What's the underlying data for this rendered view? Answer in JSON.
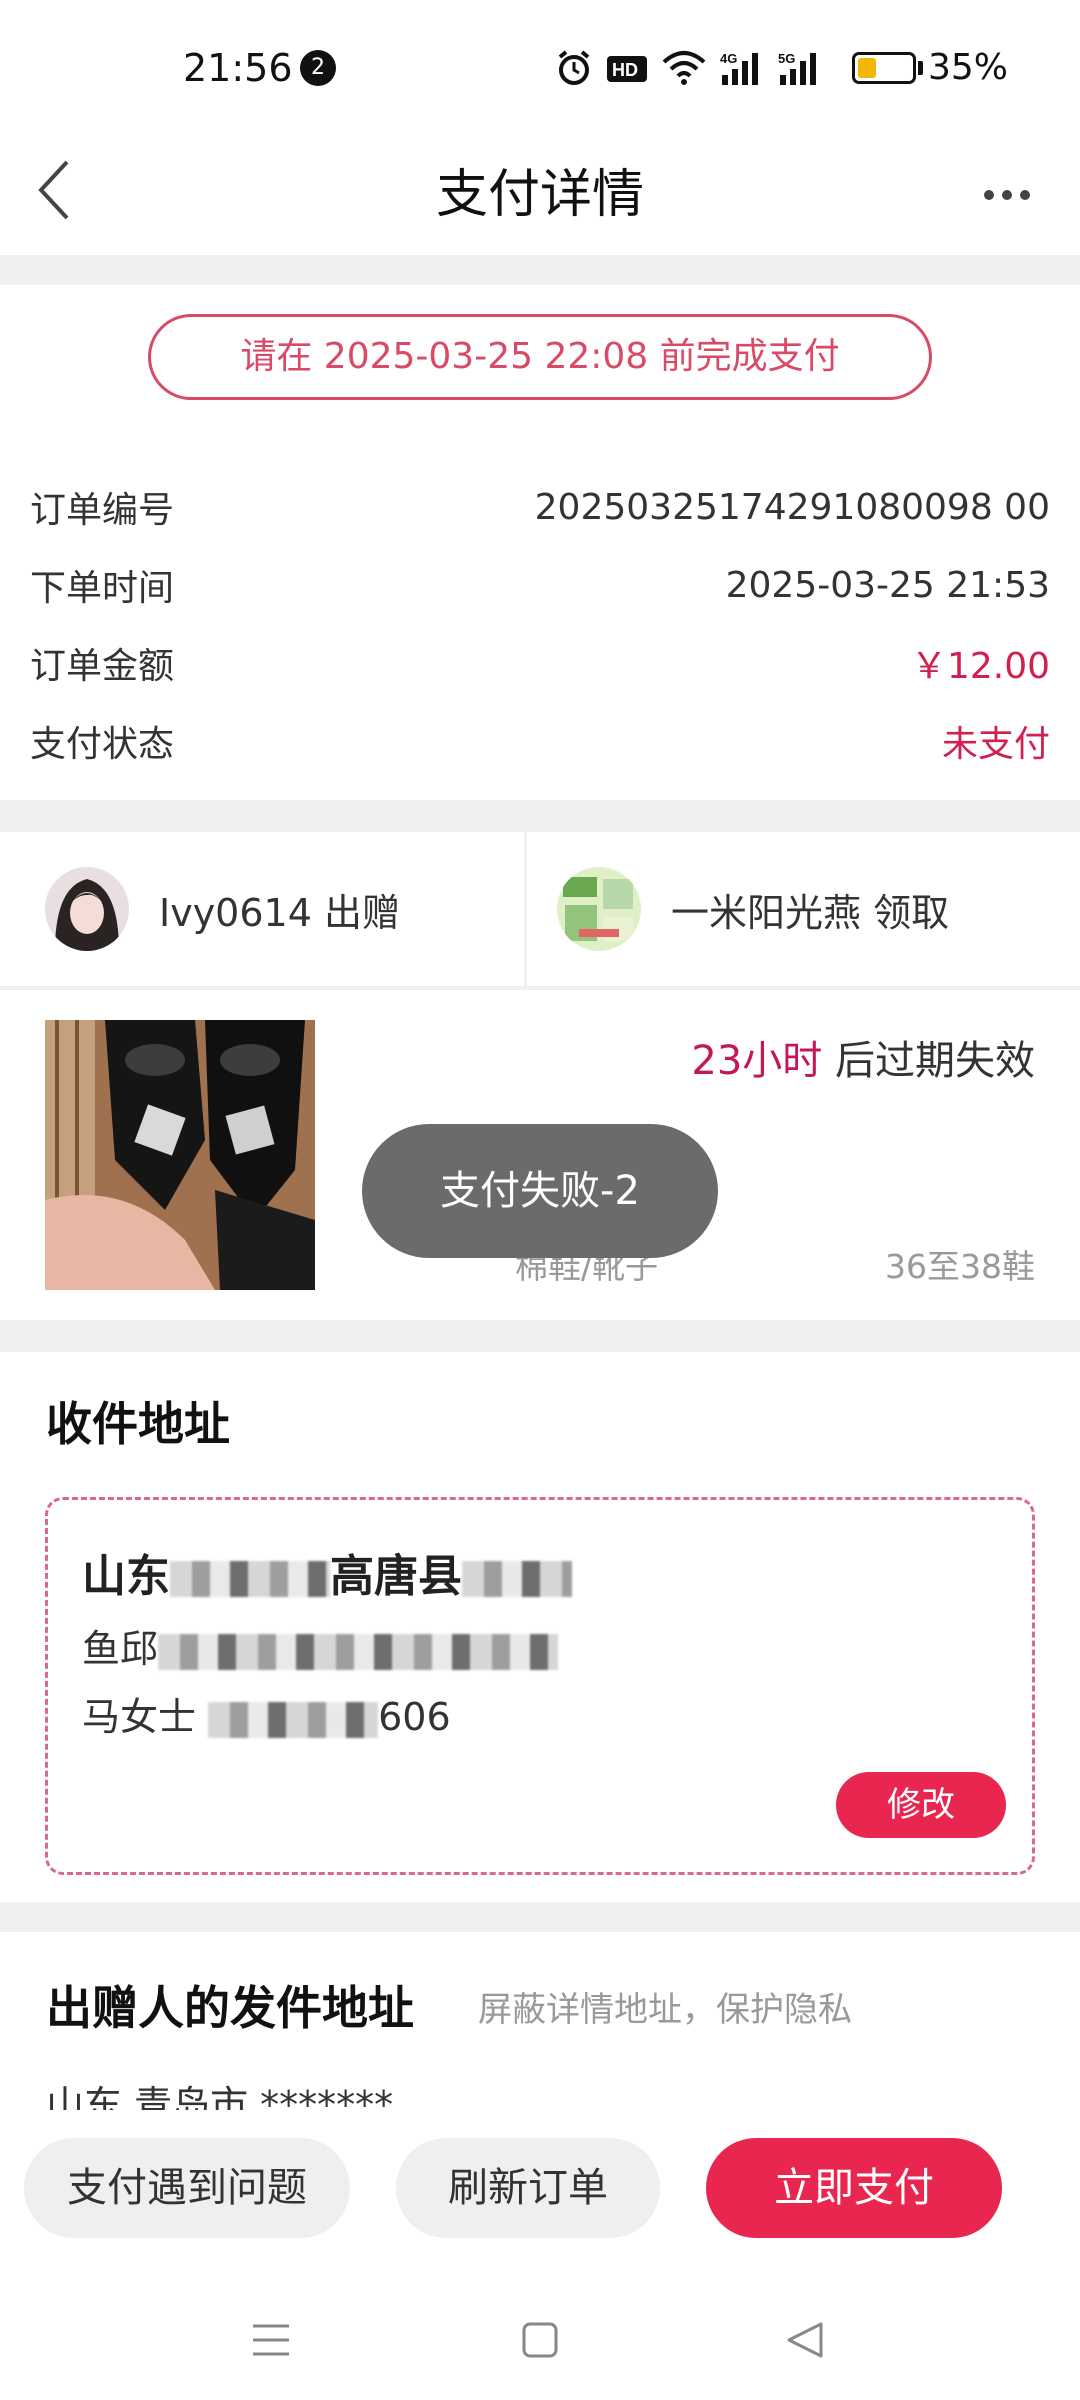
{
  "status_bar": {
    "time": "21:56",
    "notification_count": "2",
    "battery_percent": "35%",
    "battery_level": 0.35,
    "icons": [
      "alarm-icon",
      "hd-voice-icon",
      "wifi-icon",
      "signal-4g-icon",
      "signal-5g-icon"
    ],
    "hd_label": "HD",
    "net_4g": "4G",
    "net_5g": "5G"
  },
  "header": {
    "title": "支付详情",
    "back_icon": "chevron-left-icon",
    "more_icon": "more-dots-icon"
  },
  "order": {
    "deadline_notice": "请在 2025-03-25 22:08 前完成支付",
    "rows": [
      {
        "label": "订单编号",
        "value": "20250325174291080098 00"
      },
      {
        "label": "下单时间",
        "value": "2025-03-25 21:53"
      },
      {
        "label": "订单金额",
        "value": "￥12.00"
      },
      {
        "label": "支付状态",
        "value": "未支付"
      }
    ]
  },
  "parties": {
    "giver": "Ivy0614 出赠",
    "receiver": "一米阳光燕 领取"
  },
  "product": {
    "expire_hours": "23小时",
    "expire_suffix": " 后过期失效",
    "category": "棉鞋/靴子",
    "size": "36至38鞋"
  },
  "toast": "支付失败-2",
  "shipping_address": {
    "title": "收件地址",
    "line1_prefix": "山东",
    "line1_mid": "高唐县",
    "line2_prefix": "鱼邱",
    "line3_prefix": "马女士",
    "line3_suffix": "606",
    "edit_label": "修改"
  },
  "sender_address": {
    "title": "出赠人的发件地址",
    "note": "屏蔽详情地址，保护隐私",
    "address": "山东 青岛市 *******"
  },
  "actions": {
    "problem_label": "支付遇到问题",
    "refresh_label": "刷新订单",
    "pay_label": "立即支付"
  },
  "colors": {
    "accent": "#e8264f",
    "price_red": "#d1204f",
    "deadline_pink": "#d94a67"
  }
}
